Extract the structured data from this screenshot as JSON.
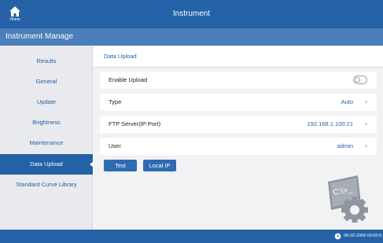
{
  "header": {
    "home_label": "Home",
    "title": "Instrument"
  },
  "subheader": {
    "title": "Instrument Manage"
  },
  "sidebar": {
    "items": [
      {
        "label": "Results"
      },
      {
        "label": "General"
      },
      {
        "label": "Update"
      },
      {
        "label": "Brightness"
      },
      {
        "label": "Maintenance"
      },
      {
        "label": "Data Upload",
        "active": true
      },
      {
        "label": "Standard Curve Library"
      }
    ]
  },
  "main": {
    "section_title": "Data Upload",
    "rows": [
      {
        "label": "Enable Upload",
        "control": "toggle",
        "enabled": false
      },
      {
        "label": "Type",
        "value": "Auto"
      },
      {
        "label": "FTP Server(IP:Port)",
        "value": "192.168.1.100:21"
      },
      {
        "label": "User",
        "value": "admin"
      }
    ],
    "buttons": {
      "test_label": "Test",
      "local_ip_label": "Local IP"
    },
    "illustration_text": "C:\\>_"
  },
  "footer": {
    "datetime": "09-02-2009 00:00:0"
  },
  "colors": {
    "primary": "#2461a6",
    "subheader": "#4a7eb8",
    "sidebar_bg": "#e9eaed",
    "content_bg": "#f1f2f4"
  },
  "icons": {
    "home": "home-icon",
    "chevron": "chevron-right-icon",
    "clock": "clock-icon",
    "illustration": "terminal-gear-icon"
  }
}
